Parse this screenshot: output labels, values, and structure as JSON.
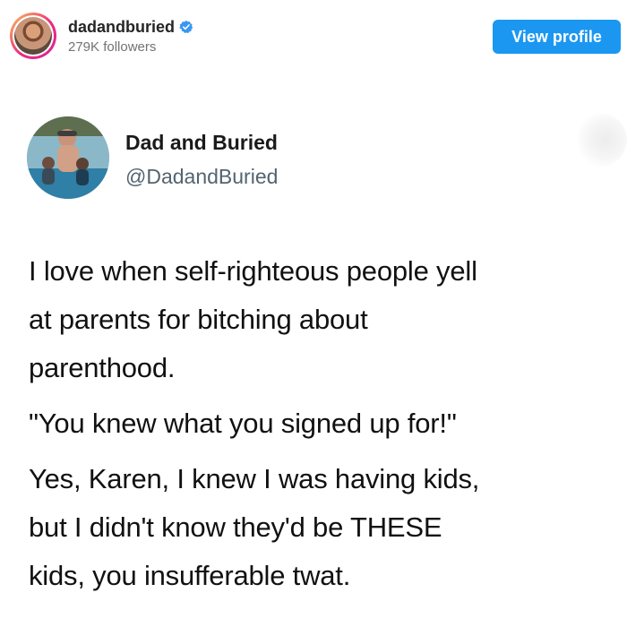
{
  "instagram": {
    "username": "dadandburied",
    "followers": "279K followers",
    "view_profile_label": "View profile",
    "verified_icon": "verified-badge-icon",
    "accent_color": "#1b97f1"
  },
  "tweet": {
    "display_name": "Dad and Buried",
    "handle": "@DadandBuried",
    "paragraphs": [
      "I love when self-righteous people yell\nat parents for bitching about\nparenthood.",
      "\"You knew what you signed up for!\"",
      "Yes, Karen, I knew I was having kids,\nbut I didn't know they'd be THESE\nkids, you insufferable twat."
    ]
  }
}
